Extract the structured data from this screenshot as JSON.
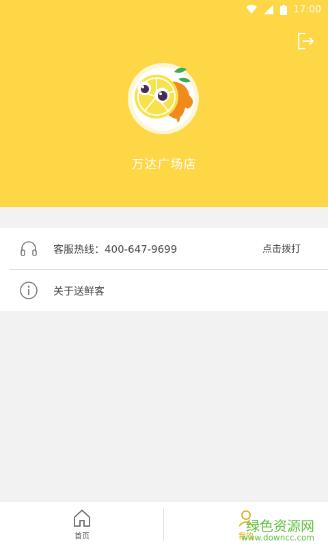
{
  "status_bar": {
    "time": "17:00",
    "icons": [
      "wifi-icon",
      "signal-icon",
      "battery-icon"
    ]
  },
  "header": {
    "store_name": "万达广场店",
    "logout_icon": "logout-icon",
    "avatar": "orange-mascot-logo"
  },
  "menu": {
    "items": [
      {
        "icon": "headset-icon",
        "label": "客服热线：400-647-9699",
        "action": "点击拨打"
      },
      {
        "icon": "info-icon",
        "label": "关于送鲜客"
      }
    ]
  },
  "tabbar": {
    "tabs": [
      {
        "icon": "home-icon",
        "label": "首页"
      },
      {
        "icon": "profile-icon",
        "label": "我的"
      }
    ]
  },
  "watermark": {
    "title": "绿色资源网",
    "url": "www.downcc.com"
  },
  "colors": {
    "header_bg": "#fdd746",
    "active_tab": "#e0a800"
  }
}
